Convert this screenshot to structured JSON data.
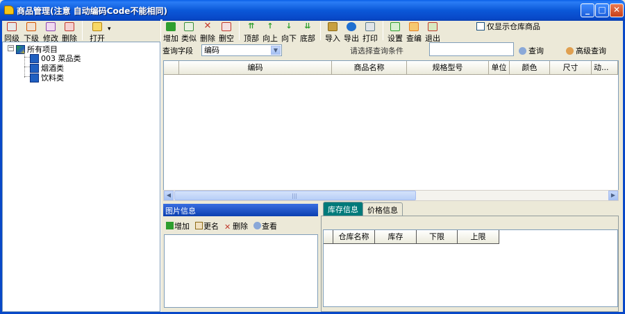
{
  "window": {
    "title": "商品管理(注意 自动编码Code不能相同)",
    "min_label": "_",
    "max_label": "□",
    "close_label": "✕"
  },
  "left_toolbar": {
    "items": [
      {
        "label": "同级",
        "icon": "sibling-icon",
        "color": "#C0392B"
      },
      {
        "label": "下级",
        "icon": "child-icon",
        "color": "#D35400"
      },
      {
        "label": "修改",
        "icon": "edit-icon",
        "color": "#8E44AD"
      },
      {
        "label": "删除",
        "icon": "delete-icon",
        "color": "#C0392B"
      }
    ],
    "open_label": "打开",
    "open_icon": "folder-icon"
  },
  "main_toolbar": {
    "items": [
      {
        "label": "增加",
        "icon": "add-icon",
        "color": "#2E9E2E"
      },
      {
        "label": "类似",
        "icon": "similar-icon",
        "color": "#3A8E3A"
      },
      {
        "label": "删除",
        "icon": "delete-icon",
        "color": "#C0392B"
      },
      {
        "label": "删空",
        "icon": "clear-icon",
        "color": "#C0392B"
      },
      {
        "label": "顶部",
        "icon": "top-icon",
        "color": "#2E9E2E"
      },
      {
        "label": "向上",
        "icon": "up-icon",
        "color": "#2E9E2E"
      },
      {
        "label": "向下",
        "icon": "down-icon",
        "color": "#2E9E2E"
      },
      {
        "label": "底部",
        "icon": "bottom-icon",
        "color": "#2E9E2E"
      },
      {
        "label": "导入",
        "icon": "import-icon",
        "color": "#B8860B"
      },
      {
        "label": "导出",
        "icon": "export-icon",
        "color": "#1F6FD0"
      },
      {
        "label": "打印",
        "icon": "print-icon",
        "color": "#607D8B"
      },
      {
        "label": "设置",
        "icon": "settings-icon",
        "color": "#2E9E2E"
      },
      {
        "label": "查编",
        "icon": "find-edit-icon",
        "color": "#E67E22"
      },
      {
        "label": "退出",
        "icon": "exit-icon",
        "color": "#C0392B"
      }
    ],
    "only_warehouse_label": "仅显示仓库商品",
    "only_warehouse_checked": false
  },
  "tree": {
    "root": "所有项目",
    "children": [
      "003 菜品类",
      "烟酒类",
      "饮料类"
    ]
  },
  "query": {
    "field_label": "查询字段",
    "field_value": "编码",
    "condition_label": "请选择查询条件",
    "condition_value": "",
    "search_label": "查询",
    "advanced_label": "高级查询"
  },
  "grid": {
    "columns": [
      "",
      "编码",
      "商品名称",
      "规格型号",
      "单位",
      "颜色",
      "尺寸",
      "动..."
    ],
    "rows": []
  },
  "scroll": {
    "left_arrow": "◀",
    "right_arrow": "▶",
    "thumb_grip": "|||"
  },
  "image_panel": {
    "title": "图片信息",
    "add_label": "增加",
    "rename_label": "更名",
    "delete_label": "删除",
    "view_label": "查看"
  },
  "tabs": [
    {
      "label": "库存信息",
      "active": true
    },
    {
      "label": "价格信息",
      "active": false
    }
  ],
  "stock_grid": {
    "columns": [
      "",
      "仓库名称",
      "库存",
      "下限",
      "上限"
    ],
    "rows": []
  }
}
